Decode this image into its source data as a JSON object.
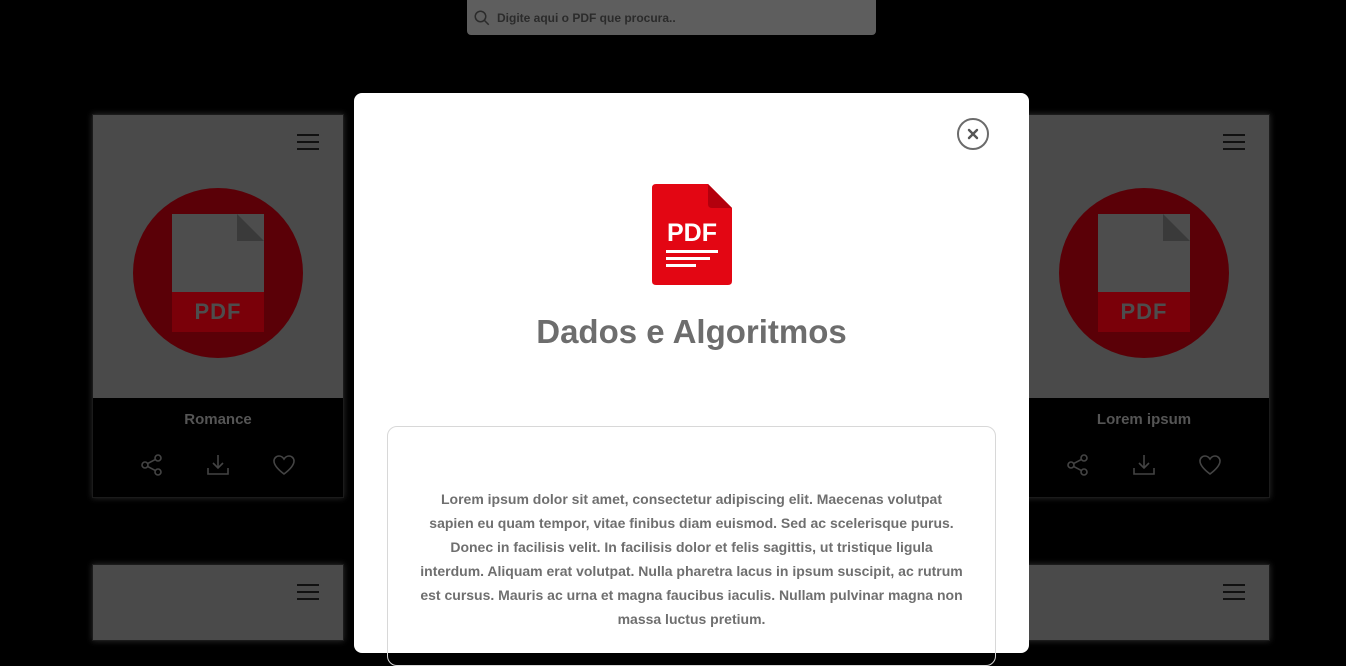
{
  "search": {
    "placeholder": "Digite aqui o PDF que procura.."
  },
  "cards": [
    {
      "title": "Romance",
      "badge": "PDF"
    },
    {
      "title": "Lorem ipsum",
      "badge": "PDF"
    }
  ],
  "modal": {
    "icon_label": "PDF",
    "title": "Dados e Algoritmos",
    "description": "Lorem ipsum dolor sit amet, consectetur adipiscing elit. Maecenas volutpat sapien eu quam tempor, vitae finibus diam euismod. Sed ac scelerisque purus. Donec in facilisis velit. In facilisis dolor et felis sagittis, ut tristique ligula interdum. Aliquam erat volutpat. Nulla pharetra lacus in ipsum suscipit, ac rutrum est cursus. Mauris ac urna et magna faucibus iaculis. Nullam pulvinar magna non massa luctus pretium."
  },
  "colors": {
    "accent": "#e30613",
    "overlay": "#000000",
    "text_gray": "#6d6d6d"
  }
}
